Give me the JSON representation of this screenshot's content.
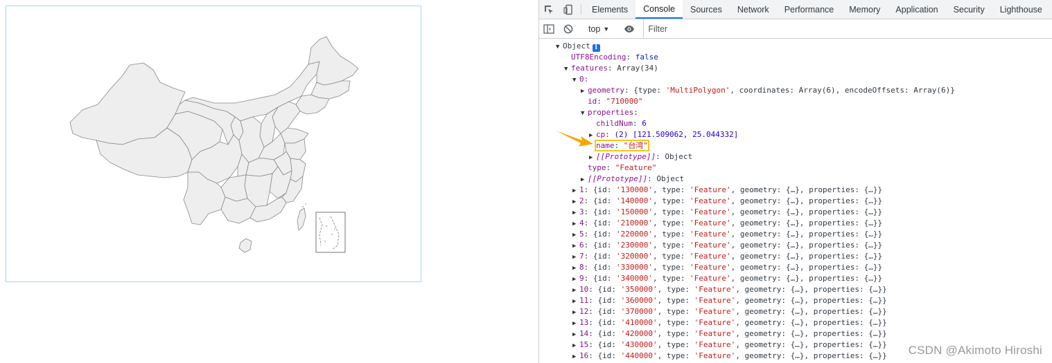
{
  "devtools": {
    "tabs": [
      "Elements",
      "Console",
      "Sources",
      "Network",
      "Performance",
      "Memory",
      "Application",
      "Security",
      "Lighthouse"
    ],
    "active_tab": "Console",
    "context": "top",
    "filter_placeholder": "Filter"
  },
  "console": {
    "object_label": "Object",
    "utf8": "false",
    "features_summary": "Array(34)",
    "item0_index": "0:",
    "geometry_summary": [
      "MultiPolygon",
      "Array(6)",
      "Array(6)"
    ],
    "id_value": "\"710000\"",
    "childnum_value": "6",
    "cp_value": "(2) [121.509062, 25.044332]",
    "name_value": "\"台湾\"",
    "prototype_value": "Object",
    "type_value": "\"Feature\"",
    "rows": [
      {
        "idx": "1",
        "id": "130000"
      },
      {
        "idx": "2",
        "id": "140000"
      },
      {
        "idx": "3",
        "id": "150000"
      },
      {
        "idx": "4",
        "id": "210000"
      },
      {
        "idx": "5",
        "id": "220000"
      },
      {
        "idx": "6",
        "id": "230000"
      },
      {
        "idx": "7",
        "id": "320000"
      },
      {
        "idx": "8",
        "id": "330000"
      },
      {
        "idx": "9",
        "id": "340000"
      },
      {
        "idx": "10",
        "id": "350000"
      },
      {
        "idx": "11",
        "id": "360000"
      },
      {
        "idx": "12",
        "id": "370000"
      },
      {
        "idx": "13",
        "id": "410000"
      },
      {
        "idx": "14",
        "id": "420000"
      },
      {
        "idx": "15",
        "id": "430000"
      },
      {
        "idx": "16",
        "id": "440000"
      }
    ]
  },
  "watermark": "CSDN @Akimoto Hiroshi",
  "colors": {
    "map_fill": "#eeeeee",
    "map_stroke": "#888888",
    "map_border": "#a9d4ea",
    "accent": "#1a73e8",
    "highlight": "#f5c518"
  }
}
